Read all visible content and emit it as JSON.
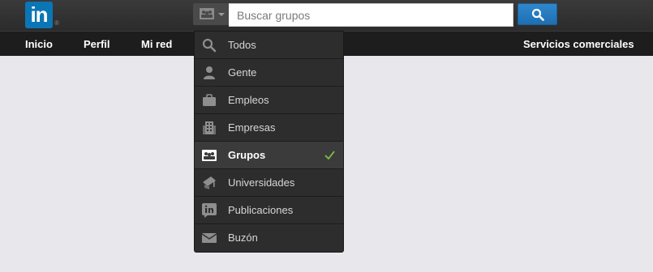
{
  "logo": {
    "text": "in",
    "mark": "®"
  },
  "search": {
    "placeholder": "Buscar grupos",
    "scope_icon": "groups-icon",
    "button_icon": "search-icon"
  },
  "nav": {
    "items": [
      "Inicio",
      "Perfil",
      "Mi red"
    ],
    "right_item": "Servicios comerciales"
  },
  "dropdown": {
    "selected_index": 4,
    "items": [
      {
        "label": "Todos",
        "icon": "search-icon"
      },
      {
        "label": "Gente",
        "icon": "person-icon"
      },
      {
        "label": "Empleos",
        "icon": "briefcase-icon"
      },
      {
        "label": "Empresas",
        "icon": "building-icon"
      },
      {
        "label": "Grupos",
        "icon": "groups-icon"
      },
      {
        "label": "Universidades",
        "icon": "university-icon"
      },
      {
        "label": "Publicaciones",
        "icon": "linkedin-post-icon"
      },
      {
        "label": "Buzón",
        "icon": "envelope-icon"
      }
    ]
  },
  "colors": {
    "brand": "#0b76b5",
    "search_button": "#1f6fb2",
    "check": "#7cc142"
  }
}
